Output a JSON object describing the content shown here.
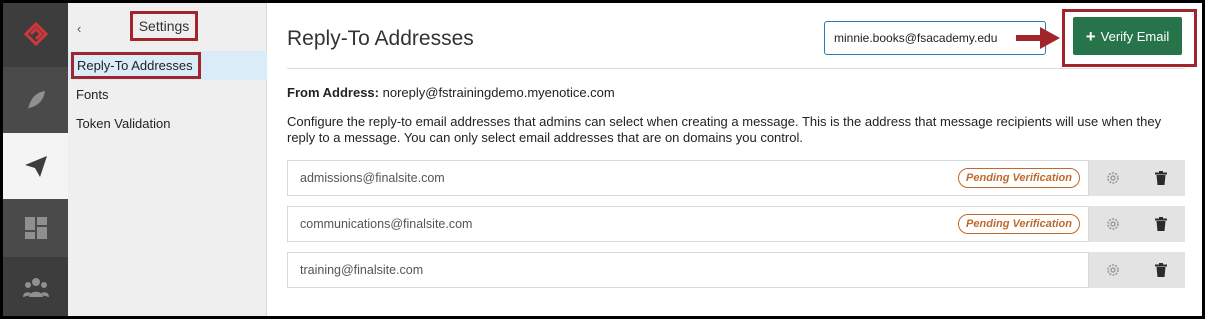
{
  "rail": {
    "items": [
      "logo-icon",
      "feather-icon",
      "send-icon",
      "dashboard-icon",
      "people-icon"
    ],
    "colors": {
      "logo": "#d1363c",
      "icon": "#8f8f8f",
      "active_icon": "#3d3d3d"
    }
  },
  "sidebar": {
    "back": "‹",
    "title": "Settings",
    "items": [
      {
        "label": "Reply-To Addresses",
        "active": true
      },
      {
        "label": "Fonts",
        "active": false
      },
      {
        "label": "Token Validation",
        "active": false
      }
    ]
  },
  "main": {
    "title": "Reply-To Addresses",
    "email_input_value": "minnie.books@fsacademy.edu",
    "verify_button": {
      "plus": "+",
      "label": "Verify Email"
    },
    "from_label": "From Address:",
    "from_value": "noreply@fstrainingdemo.myenotice.com",
    "description": "Configure the reply-to email addresses that admins can select when creating a message. This is the address that message recipients will use when they reply to a message. You can only select email addresses that are on domains you control.",
    "addresses": [
      {
        "email": "admissions@finalsite.com",
        "status": "Pending Verification"
      },
      {
        "email": "communications@finalsite.com",
        "status": "Pending Verification"
      },
      {
        "email": "training@finalsite.com",
        "status": ""
      }
    ]
  },
  "colors": {
    "annotation": "#a1252b",
    "verify_button": "#27744a",
    "pending": "#c0692a",
    "active_nav": "#d9ecf7"
  }
}
